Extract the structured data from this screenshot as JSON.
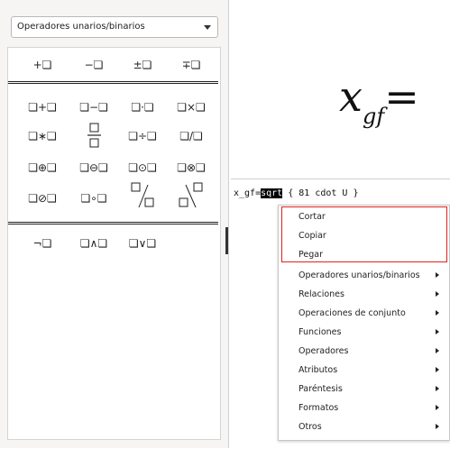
{
  "sidebar": {
    "dropdown_value": "Operadores unarios/binarios",
    "groups": [
      [
        "+❏",
        "−❏",
        "±❏",
        "∓❏"
      ],
      [
        "❏+❏",
        "❏−❏",
        "❏·❏",
        "❏×❏",
        "❏∗❏",
        "❏÷❏",
        "❏/❏",
        "❏⊕❏",
        "❏⊖❏",
        "❏⊙❏",
        "❏⊗❏",
        "❏⊘❏",
        "❏∘❏"
      ],
      [
        "¬❏",
        "❏∧❏",
        "❏∨❏"
      ]
    ]
  },
  "formula": {
    "main": "x",
    "sub": "gf",
    "op": "="
  },
  "editor": {
    "code_before": "x_gf=",
    "code_selected": "sqrt",
    "code_after": " { 81 cdot U }"
  },
  "context_menu": {
    "items": [
      {
        "label": "Cortar",
        "submenu": false
      },
      {
        "label": "Copiar",
        "submenu": false
      },
      {
        "label": "Pegar",
        "submenu": false
      },
      {
        "label": "Operadores unarios/binarios",
        "submenu": true
      },
      {
        "label": "Relaciones",
        "submenu": true
      },
      {
        "label": "Operaciones de conjunto",
        "submenu": true
      },
      {
        "label": "Funciones",
        "submenu": true
      },
      {
        "label": "Operadores",
        "submenu": true
      },
      {
        "label": "Atributos",
        "submenu": true
      },
      {
        "label": "Paréntesis",
        "submenu": true
      },
      {
        "label": "Formatos",
        "submenu": true
      },
      {
        "label": "Otros",
        "submenu": true
      }
    ]
  },
  "colors": {
    "highlight_border": "#e02020",
    "selection_bg": "#000000"
  }
}
